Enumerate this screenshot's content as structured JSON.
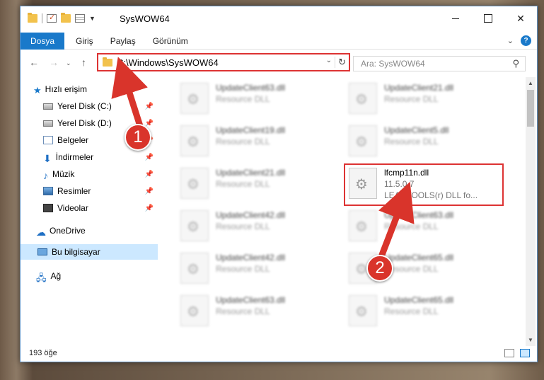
{
  "window": {
    "title": "SysWOW64"
  },
  "ribbon": {
    "tabs": [
      "Dosya",
      "Giriş",
      "Paylaş",
      "Görünüm"
    ]
  },
  "nav": {
    "address": "C:\\Windows\\SysWOW64",
    "search_placeholder": "Ara: SysWOW64"
  },
  "sidebar": {
    "quick_access": "Hızlı erişim",
    "items": [
      {
        "label": "Yerel Disk (C:)",
        "icon": "drive-icon",
        "pinned": true
      },
      {
        "label": "Yerel Disk (D:)",
        "icon": "drive-icon",
        "pinned": true
      },
      {
        "label": "Belgeler",
        "icon": "documents-icon",
        "pinned": true
      },
      {
        "label": "İndirmeler",
        "icon": "download-icon",
        "pinned": true
      },
      {
        "label": "Müzik",
        "icon": "music-icon",
        "pinned": true
      },
      {
        "label": "Resimler",
        "icon": "pictures-icon",
        "pinned": true
      },
      {
        "label": "Videolar",
        "icon": "videos-icon",
        "pinned": true
      }
    ],
    "onedrive": "OneDrive",
    "this_pc": "Bu bilgisayar",
    "network": "Ağ"
  },
  "files": [
    {
      "name": "UpdateClient63.dll",
      "line2": "Resource DLL",
      "line3": ""
    },
    {
      "name": "UpdateClient21.dll",
      "line2": "Resource DLL",
      "line3": ""
    },
    {
      "name": "UpdateClient19.dll",
      "line2": "Resource DLL",
      "line3": ""
    },
    {
      "name": "UpdateClient5.dll",
      "line2": "Resource DLL",
      "line3": ""
    },
    {
      "name": "UpdateClient21.dll",
      "line2": "Resource DLL",
      "line3": ""
    },
    {
      "name": "lfcmp11n.dll",
      "line2": "11.5.0.7",
      "line3": "LEADTOOLS(r) DLL fo..."
    },
    {
      "name": "UpdateClient42.dll",
      "line2": "Resource DLL",
      "line3": ""
    },
    {
      "name": "UpdateClient63.dll",
      "line2": "Resource DLL",
      "line3": ""
    },
    {
      "name": "UpdateClient42.dll",
      "line2": "Resource DLL",
      "line3": ""
    },
    {
      "name": "UpdateClient65.dll",
      "line2": "Resource DLL",
      "line3": ""
    },
    {
      "name": "UpdateClient63.dll",
      "line2": "Resource DLL",
      "line3": ""
    },
    {
      "name": "UpdateClient65.dll",
      "line2": "Resource DLL",
      "line3": ""
    }
  ],
  "status": {
    "count": "193 öğe"
  },
  "annotations": {
    "step1": "1",
    "step2": "2"
  },
  "colors": {
    "accent": "#1979ca",
    "highlight": "#d33333"
  }
}
